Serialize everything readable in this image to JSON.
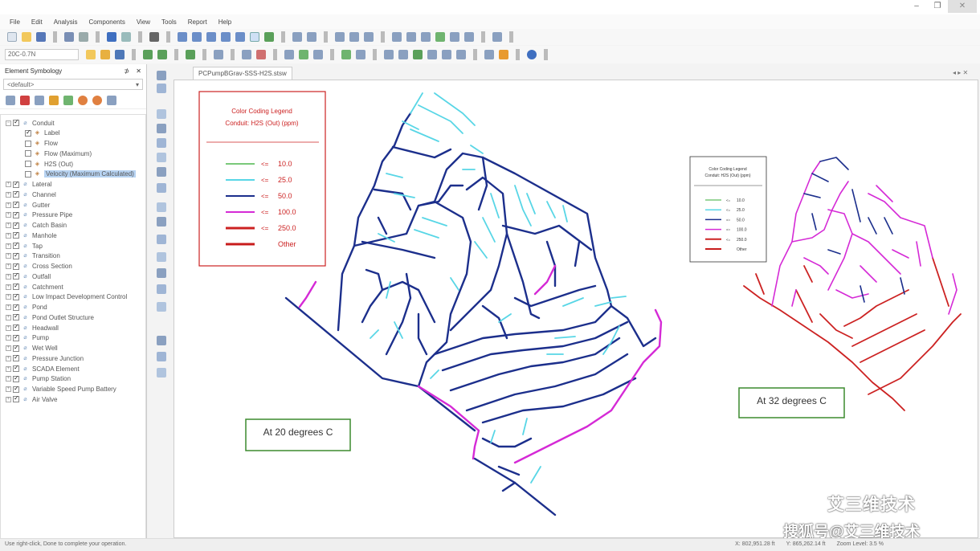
{
  "window": {
    "buttons": [
      "–",
      "❐",
      "✕"
    ]
  },
  "menu": [
    "File",
    "Edit",
    "Analysis",
    "Components",
    "View",
    "Tools",
    "Report",
    "Help"
  ],
  "toolbar": {
    "scenario_combo": "20C-0.7N"
  },
  "panel": {
    "title": "Element Symbology",
    "pin": "⊅",
    "close": "✕",
    "combo": "<default>",
    "combo_arrow": "▾",
    "tree": [
      {
        "label": "Conduit",
        "expand": "⊟",
        "checked": true,
        "level": 0
      },
      {
        "label": "Label",
        "checked": true,
        "level": 1
      },
      {
        "label": "Flow",
        "checked": false,
        "level": 1
      },
      {
        "label": "Flow (Maximum)",
        "checked": false,
        "level": 1
      },
      {
        "label": "H2S (Out)",
        "checked": false,
        "level": 1
      },
      {
        "label": "Velocity (Maximum Calculated)",
        "checked": false,
        "level": 1,
        "selected": true
      },
      {
        "label": "Lateral",
        "expand": "⊞",
        "checked": true,
        "level": 0
      },
      {
        "label": "Channel",
        "expand": "⊞",
        "checked": true,
        "level": 0
      },
      {
        "label": "Gutter",
        "expand": "⊞",
        "checked": true,
        "level": 0
      },
      {
        "label": "Pressure Pipe",
        "expand": "⊞",
        "checked": true,
        "level": 0
      },
      {
        "label": "Catch Basin",
        "expand": "⊞",
        "checked": true,
        "level": 0
      },
      {
        "label": "Manhole",
        "expand": "⊞",
        "checked": true,
        "level": 0
      },
      {
        "label": "Tap",
        "expand": "⊞",
        "checked": true,
        "level": 0
      },
      {
        "label": "Transition",
        "expand": "⊞",
        "checked": true,
        "level": 0
      },
      {
        "label": "Cross Section",
        "expand": "⊞",
        "checked": true,
        "level": 0
      },
      {
        "label": "Outfall",
        "expand": "⊞",
        "checked": true,
        "level": 0
      },
      {
        "label": "Catchment",
        "expand": "⊞",
        "checked": true,
        "level": 0
      },
      {
        "label": "Low Impact Development Control",
        "expand": "⊞",
        "checked": true,
        "level": 0
      },
      {
        "label": "Pond",
        "expand": "⊞",
        "checked": true,
        "level": 0
      },
      {
        "label": "Pond Outlet Structure",
        "expand": "⊞",
        "checked": true,
        "level": 0
      },
      {
        "label": "Headwall",
        "expand": "⊞",
        "checked": true,
        "level": 0
      },
      {
        "label": "Pump",
        "expand": "⊞",
        "checked": true,
        "level": 0
      },
      {
        "label": "Wet Well",
        "expand": "⊞",
        "checked": true,
        "level": 0
      },
      {
        "label": "Pressure Junction",
        "expand": "⊞",
        "checked": true,
        "level": 0
      },
      {
        "label": "SCADA Element",
        "expand": "⊞",
        "checked": true,
        "level": 0
      },
      {
        "label": "Pump Station",
        "expand": "⊞",
        "checked": true,
        "level": 0
      },
      {
        "label": "Variable Speed Pump Battery",
        "expand": "⊞",
        "checked": true,
        "level": 0
      },
      {
        "label": "Air Valve",
        "expand": "⊞",
        "checked": true,
        "level": 0
      }
    ]
  },
  "tab": {
    "label": "PCPumpBGrav-SSS-H2S.stsw",
    "nav": "◂ ▸ ✕"
  },
  "legend": {
    "title1": "Color Coding Legend",
    "title2": "Conduit: H2S (Out) (ppm)",
    "items": [
      {
        "op": "<=",
        "value": "10.0",
        "color": "#7ac97a"
      },
      {
        "op": "<=",
        "value": "25.0",
        "color": "#58d6e6"
      },
      {
        "op": "<=",
        "value": "50.0",
        "color": "#1c2f8c"
      },
      {
        "op": "<=",
        "value": "100.0",
        "color": "#d52ad6"
      },
      {
        "op": "<=",
        "value": "250.0",
        "color": "#cc2222"
      },
      {
        "op": "",
        "value": "Other",
        "color": "#c81c1c"
      }
    ],
    "accent": "#cc2222"
  },
  "labels": {
    "left": "At 20 degrees C",
    "right": "At 32 degrees C",
    "border": "#3c8a2e"
  },
  "status": {
    "hint": "Use right-click, Done to complete your operation.",
    "x": "X: 802,951.28 ft",
    "y": "Y: 865,262.14 ft",
    "zoom": "Zoom Level: 3.5 %"
  },
  "watermark": {
    "line1": "艾三维技术",
    "line2": "搜狐号@艾三维技术"
  }
}
